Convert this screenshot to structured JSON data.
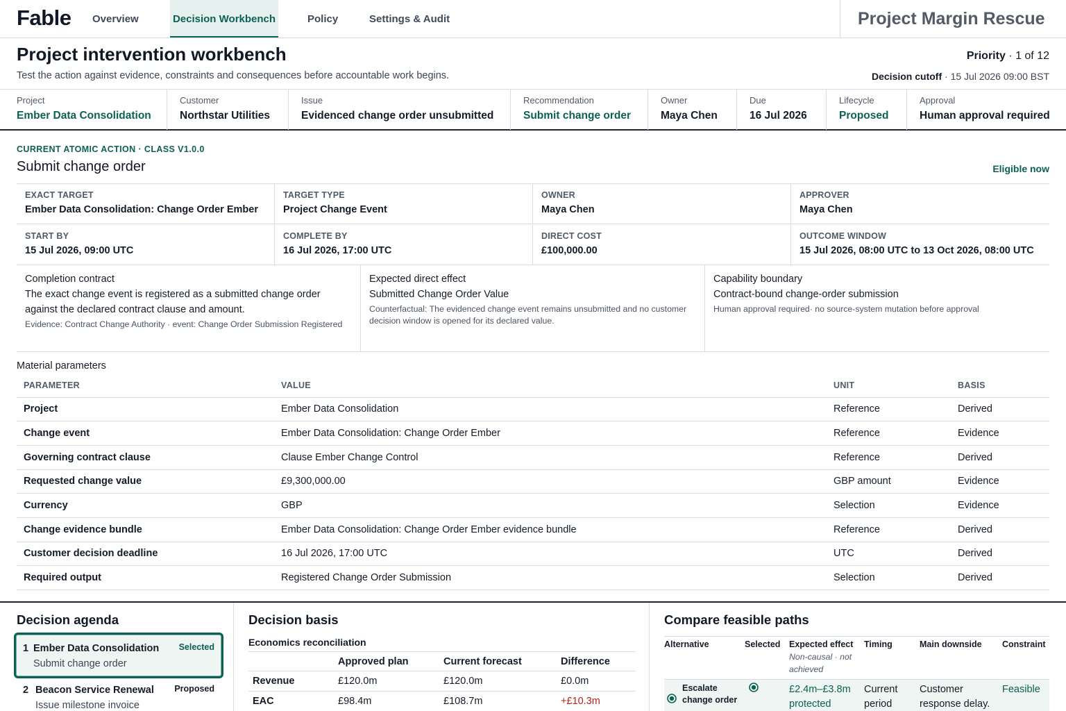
{
  "nav": {
    "logo": "Fable",
    "tabs": [
      "Overview",
      "Decision Workbench",
      "Policy",
      "Settings & Audit"
    ],
    "active_tab": "Decision Workbench",
    "project_name": "Project Margin Rescue"
  },
  "header": {
    "title": "Project intervention workbench",
    "subtitle": "Test the action against evidence, constraints and consequences before accountable work begins.",
    "priority_label": "Priority",
    "priority_value": " · 1 of 12",
    "cutoff_label": "Decision cutoff",
    "cutoff_value": " · 15 Jul 2026 09:00 BST"
  },
  "meta": {
    "project": {
      "label": "Project",
      "value": "Ember Data Consolidation"
    },
    "customer": {
      "label": "Customer",
      "value": "Northstar Utilities"
    },
    "issue": {
      "label": "Issue",
      "value": "Evidenced change order unsubmitted"
    },
    "recommendation": {
      "label": "Recommendation",
      "value": "Submit change order"
    },
    "owner": {
      "label": "Owner",
      "value": "Maya Chen"
    },
    "due": {
      "label": "Due",
      "value": "16 Jul 2026"
    },
    "lifecycle": {
      "label": "Lifecycle",
      "value": "Proposed"
    },
    "approval": {
      "label": "Approval",
      "value": "Human approval required"
    }
  },
  "action": {
    "kicker": "CURRENT ATOMIC ACTION · CLASS V1.0.0",
    "title": "Submit change order",
    "status": "Eligible now",
    "fields": {
      "exact_target": {
        "label": "EXACT TARGET",
        "value": "Ember Data Consolidation: Change Order Ember"
      },
      "target_type": {
        "label": "TARGET TYPE",
        "value": "Project Change Event"
      },
      "owner": {
        "label": "OWNER",
        "value": "Maya Chen"
      },
      "approver": {
        "label": "APPROVER",
        "value": "Maya Chen"
      },
      "start_by": {
        "label": "START BY",
        "value": "15 Jul 2026, 09:00 UTC"
      },
      "complete_by": {
        "label": "COMPLETE BY",
        "value": "16 Jul 2026, 17:00 UTC"
      },
      "direct_cost": {
        "label": "DIRECT COST",
        "value": "£100,000.00"
      },
      "outcome_window": {
        "label": "OUTCOME WINDOW",
        "value": "15 Jul 2026, 08:00 UTC to 13 Oct 2026, 08:00 UTC"
      }
    },
    "contract": {
      "title": "Completion contract",
      "body": "The exact change event is registered as a submitted change order against the declared contract clause and amount.",
      "small": "Evidence: Contract Change Authority · event: Change Order Submission Registered"
    },
    "effect": {
      "title": "Expected direct effect",
      "body": "Submitted Change Order Value",
      "small": "Counterfactual: The evidenced change event remains unsubmitted and no customer decision window is opened for its declared value."
    },
    "capability": {
      "title": "Capability boundary",
      "body": "Contract-bound change-order submission",
      "small": "Human approval required· no source-system mutation before approval"
    }
  },
  "parameters": {
    "title": "Material parameters",
    "headers": {
      "parameter": "PARAMETER",
      "value": "VALUE",
      "unit": "UNIT",
      "basis": "BASIS"
    },
    "rows": [
      {
        "parameter": "Project",
        "value": "Ember Data Consolidation",
        "unit": "Reference",
        "basis": "Derived"
      },
      {
        "parameter": "Change event",
        "value": "Ember Data Consolidation: Change Order Ember",
        "unit": "Reference",
        "basis": "Evidence"
      },
      {
        "parameter": "Governing contract clause",
        "value": "Clause Ember Change Control",
        "unit": "Reference",
        "basis": "Derived"
      },
      {
        "parameter": "Requested change value",
        "value": "£9,300,000.00",
        "unit": "GBP amount",
        "basis": "Evidence"
      },
      {
        "parameter": "Currency",
        "value": "GBP",
        "unit": "Selection",
        "basis": "Evidence"
      },
      {
        "parameter": "Change evidence bundle",
        "value": "Ember Data Consolidation: Change Order Ember evidence bundle",
        "unit": "Reference",
        "basis": "Derived"
      },
      {
        "parameter": "Customer decision deadline",
        "value": "16 Jul 2026, 17:00 UTC",
        "unit": "UTC",
        "basis": "Derived"
      },
      {
        "parameter": "Required output",
        "value": "Registered Change Order Submission",
        "unit": "Selection",
        "basis": "Derived"
      }
    ]
  },
  "agenda": {
    "title": "Decision agenda",
    "items": [
      {
        "num": "1",
        "title": "Ember Data Consolidation",
        "subtitle": "Submit change order",
        "tag": "Selected"
      },
      {
        "num": "2",
        "title": "Beacon Service Renewal",
        "subtitle": "Issue milestone invoice",
        "tag": "Proposed"
      }
    ]
  },
  "basis": {
    "title": "Decision basis",
    "subtitle": "Economics reconciliation",
    "headers": [
      "",
      "Approved plan",
      "Current forecast",
      "Difference"
    ],
    "rows": [
      {
        "label": "Revenue",
        "plan": "£120.0m",
        "forecast": "£120.0m",
        "diff": "£0.0m"
      },
      {
        "label": "EAC",
        "plan": "£98.4m",
        "forecast": "£108.7m",
        "diff": "+£10.3m"
      }
    ]
  },
  "compare": {
    "title": "Compare feasible paths",
    "headers": {
      "alternative": "Alternative",
      "selected": "Selected",
      "effect": "Expected effect",
      "effect_note": "Non-causal · not achieved",
      "timing": "Timing",
      "downside": "Main downside",
      "constraint": "Constraint"
    },
    "rows": [
      {
        "alternative": "Escalate change order",
        "effect": "£2.4m–£3.8m protected",
        "timing": "Current period",
        "downside": "Customer response delay.",
        "constraint": "Feasible"
      }
    ]
  }
}
